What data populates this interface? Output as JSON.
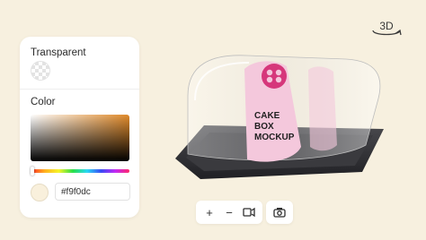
{
  "panel": {
    "transparent_label": "Transparent",
    "color_label": "Color",
    "hex_value": "#f9f0dc",
    "hue_position": 0.0
  },
  "view_mode_label": "3D",
  "toolbar": {
    "zoom_in": "+",
    "zoom_out": "−"
  },
  "product": {
    "label_line1": "CAKE",
    "label_line2": "BOX",
    "label_line3": "MOCKUP"
  },
  "colors": {
    "background": "#f7f0df",
    "label_pink": "#f4c8dc",
    "logo_magenta": "#d6377b",
    "tray_dark": "#2c2c30"
  }
}
